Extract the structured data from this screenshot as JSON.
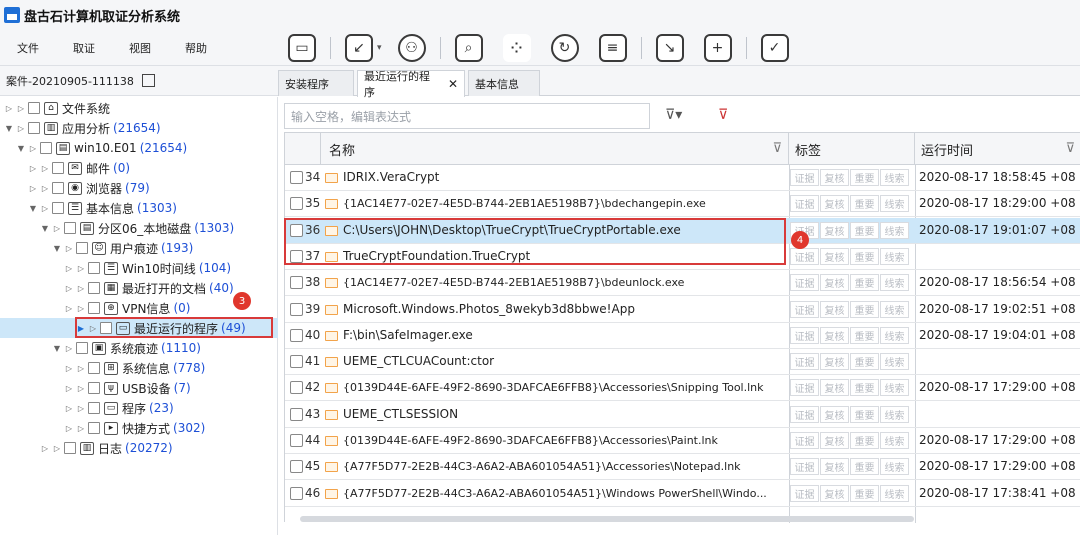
{
  "app": {
    "title": "盘古石计算机取证分析系统"
  },
  "menu": [
    "文件",
    "取证",
    "视图",
    "帮助"
  ],
  "toolbar_icons": [
    "save-icon",
    "export-icon",
    "network-icon",
    "search-icon",
    "apps-icon",
    "refresh-icon",
    "report-icon",
    "screen-capture-icon",
    "toolbox-icon",
    "checklist-icon"
  ],
  "case": {
    "name": "案件-20210905-111138"
  },
  "tabs": [
    "安装程序",
    "最近运行的程序",
    "基本信息"
  ],
  "filter": {
    "placeholder": "输入空格，编辑表达式"
  },
  "tree": [
    {
      "label": "文件系统",
      "count": ""
    },
    {
      "label": "应用分析",
      "count": "(21654)"
    },
    {
      "label": "win10.E01",
      "count": "(21654)"
    },
    {
      "label": "邮件",
      "count": "(0)"
    },
    {
      "label": "浏览器",
      "count": "(79)"
    },
    {
      "label": "基本信息",
      "count": "(1303)"
    },
    {
      "label": "分区06_本地磁盘",
      "count": "(1303)"
    },
    {
      "label": "用户痕迹",
      "count": "(193)"
    },
    {
      "label": "Win10时间线",
      "count": "(104)"
    },
    {
      "label": "最近打开的文档",
      "count": "(40)"
    },
    {
      "label": "VPN信息",
      "count": "(0)"
    },
    {
      "label": "最近运行的程序",
      "count": "(49)"
    },
    {
      "label": "系统痕迹",
      "count": "(1110)"
    },
    {
      "label": "系统信息",
      "count": "(778)"
    },
    {
      "label": "USB设备",
      "count": "(7)"
    },
    {
      "label": "程序",
      "count": "(23)"
    },
    {
      "label": "快捷方式",
      "count": "(302)"
    },
    {
      "label": "日志",
      "count": "(20272)"
    }
  ],
  "grid": {
    "columns": [
      "名称",
      "标签",
      "运行时间"
    ],
    "tag_labels": [
      "证据",
      "复核",
      "重要",
      "线索"
    ],
    "rows": [
      {
        "num": "34",
        "name": "IDRIX.VeraCrypt",
        "time": "2020-08-17 18:58:45 +08"
      },
      {
        "num": "35",
        "name": "{1AC14E77-02E7-4E5D-B744-2EB1AE5198B7}\\bdechangepin.exe",
        "time": "2020-08-17 18:29:00 +08"
      },
      {
        "num": "36",
        "name": "C:\\Users\\JOHN\\Desktop\\TrueCrypt\\TrueCryptPortable.exe",
        "time": "2020-08-17 19:01:07 +08"
      },
      {
        "num": "37",
        "name": "TrueCryptFoundation.TrueCrypt",
        "time": ""
      },
      {
        "num": "38",
        "name": "{1AC14E77-02E7-4E5D-B744-2EB1AE5198B7}\\bdeunlock.exe",
        "time": "2020-08-17 18:56:54 +08"
      },
      {
        "num": "39",
        "name": "Microsoft.Windows.Photos_8wekyb3d8bbwe!App",
        "time": "2020-08-17 19:02:51 +08"
      },
      {
        "num": "40",
        "name": "F:\\bin\\SafeImager.exe",
        "time": "2020-08-17 19:04:01 +08"
      },
      {
        "num": "41",
        "name": "UEME_CTLCUACount:ctor",
        "time": ""
      },
      {
        "num": "42",
        "name": "{0139D44E-6AFE-49F2-8690-3DAFCAE6FFB8}\\Accessories\\Snipping Tool.lnk",
        "time": "2020-08-17 17:29:00 +08"
      },
      {
        "num": "43",
        "name": "UEME_CTLSESSION",
        "time": ""
      },
      {
        "num": "44",
        "name": "{0139D44E-6AFE-49F2-8690-3DAFCAE6FFB8}\\Accessories\\Paint.lnk",
        "time": "2020-08-17 17:29:00 +08"
      },
      {
        "num": "45",
        "name": "{A77F5D77-2E2B-44C3-A6A2-ABA601054A51}\\Accessories\\Notepad.lnk",
        "time": "2020-08-17 17:29:00 +08"
      },
      {
        "num": "46",
        "name": "{A77F5D77-2E2B-44C3-A6A2-ABA601054A51}\\Windows PowerShell\\Windo...",
        "time": "2020-08-17 17:38:41 +08"
      }
    ]
  },
  "annotations": {
    "tree_badge": "3",
    "grid_badge": "4",
    "highlight_color": "#d83a3a"
  }
}
